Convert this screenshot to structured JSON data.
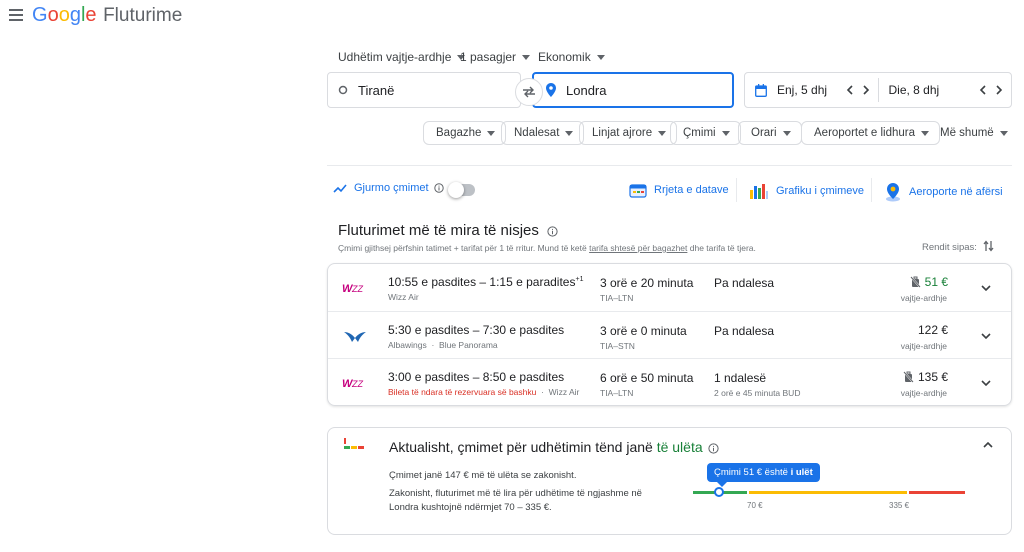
{
  "header": {
    "logo_letters": [
      "G",
      "o",
      "o",
      "g",
      "l",
      "e"
    ],
    "product": "Fluturime"
  },
  "trip": {
    "type": "Udhëtim vajtje-ardhje",
    "passengers": "1 pasagjer",
    "cabin": "Ekonomik"
  },
  "search": {
    "from": "Tiranë",
    "to": "Londra",
    "depart": "Enj, 5 dhj",
    "return": "Die, 8 dhj"
  },
  "filters": [
    "Bagazhe",
    "Ndalesat",
    "Linjat ajrore",
    "Çmimi",
    "Orari",
    "Aeroportet e lidhura",
    "Më shumë"
  ],
  "tools": {
    "track": "Gjurmo çmimet",
    "grid": "Rrjeta e datave",
    "graph": "Grafiku i çmimeve",
    "nearby": "Aeroporte në afërsi"
  },
  "section": {
    "title": "Fluturimet më të mira të nisjes",
    "note_before": "Çmimi gjithsej përfshin tatimet + tarifat për 1 të rritur. Mund të ketë ",
    "note_link": "tarifa shtesë për bagazhet",
    "note_after": " dhe tarifa të tjera.",
    "sort": "Rendit sipas:"
  },
  "flights": [
    {
      "airline_logo": "wizz-air-logo",
      "times": "10:55 e pasdites – 1:15 e paradites",
      "plus": "+1",
      "carrier": "Wizz Air",
      "warn": "",
      "operator": "",
      "duration": "3 orë e 20 minuta",
      "route": "TIA–LTN",
      "stops": "Pa ndalesa",
      "stop_detail": "",
      "price": "51 €",
      "price_type": "vajtje-ardhje",
      "low": true
    },
    {
      "airline_logo": "albawings-logo",
      "times": "5:30 e pasdites – 7:30 e pasdites",
      "plus": "",
      "carrier": "Albawings",
      "warn": "",
      "operator": "Blue Panorama",
      "duration": "3 orë e 0 minuta",
      "route": "TIA–STN",
      "stops": "Pa ndalesa",
      "stop_detail": "",
      "price": "122 €",
      "price_type": "vajtje-ardhje",
      "low": false
    },
    {
      "airline_logo": "wizz-air-logo",
      "times": "3:00 e pasdites – 8:50 e pasdites",
      "plus": "",
      "carrier": "",
      "warn": "Bileta të ndara të rezervuara së bashku",
      "operator": "Wizz Air",
      "duration": "6 orë e 50 minuta",
      "route": "TIA–LTN",
      "stops": "1 ndalesë",
      "stop_detail": "2 orë e 45 minuta BUD",
      "price": "135 €",
      "price_type": "vajtje-ardhje",
      "low": false
    }
  ],
  "insight": {
    "title_before": "Aktualisht, çmimet për udhëtimin tënd janë ",
    "title_highlight": "të ulëta",
    "p1": "Çmimet janë 147 € më të ulëta se zakonisht.",
    "p2": "Zakonisht, fluturimet më të lira për udhëtime të ngjashme në Londra kushtojnë ndërmjet 70 – 335 €.",
    "tooltip_before": "Çmimi 51 € është ",
    "tooltip_strong": "i ulët",
    "range_low": "70 €",
    "range_high": "335 €",
    "current_price_value": 51
  },
  "colors": {
    "accent": "#1a73e8",
    "low": "#188038",
    "bar_green": "#34a853",
    "bar_yellow": "#fbbc04",
    "bar_red": "#ea4335"
  }
}
